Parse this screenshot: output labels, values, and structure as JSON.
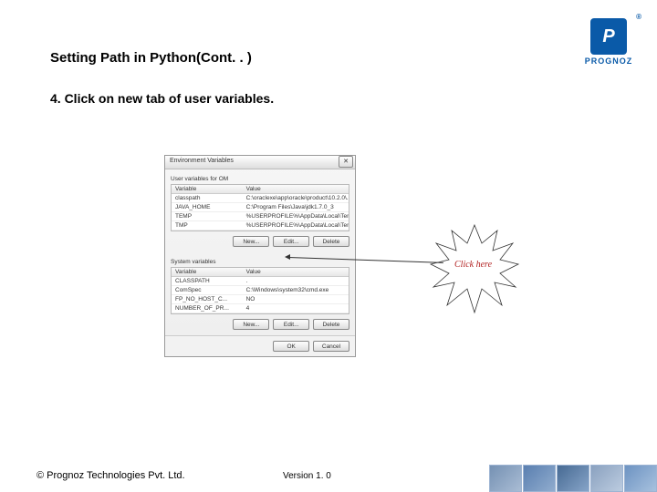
{
  "page": {
    "title": "Setting Path in Python(Cont. . )",
    "step": "4. Click on new tab of user variables."
  },
  "logo": {
    "letter": "P",
    "brand": "PROGNOZ",
    "reg": "®"
  },
  "dialog": {
    "title": "Environment Variables",
    "close": "✕",
    "user_section_label": "User variables for OM",
    "system_section_label": "System variables",
    "col_variable": "Variable",
    "col_value": "Value",
    "user_rows": [
      {
        "v": "classpath",
        "d": "C:\\oraclexe\\app\\oracle\\product\\10.2.0\\..."
      },
      {
        "v": "JAVA_HOME",
        "d": "C:\\Program Files\\Java\\jdk1.7.0_3"
      },
      {
        "v": "TEMP",
        "d": "%USERPROFILE%\\AppData\\Local\\Temp"
      },
      {
        "v": "TMP",
        "d": "%USERPROFILE%\\AppData\\Local\\Temp"
      }
    ],
    "system_rows": [
      {
        "v": "CLASSPATH",
        "d": "."
      },
      {
        "v": "ComSpec",
        "d": "C:\\Windows\\system32\\cmd.exe"
      },
      {
        "v": "FP_NO_HOST_C...",
        "d": "NO"
      },
      {
        "v": "NUMBER_OF_PR...",
        "d": "4"
      }
    ],
    "btn_new": "New...",
    "btn_edit": "Edit...",
    "btn_delete": "Delete",
    "btn_ok": "OK",
    "btn_cancel": "Cancel"
  },
  "callout": {
    "label": "Click here"
  },
  "footer": {
    "copyright": "© Prognoz Technologies Pvt. Ltd.",
    "version": "Version 1. 0"
  }
}
